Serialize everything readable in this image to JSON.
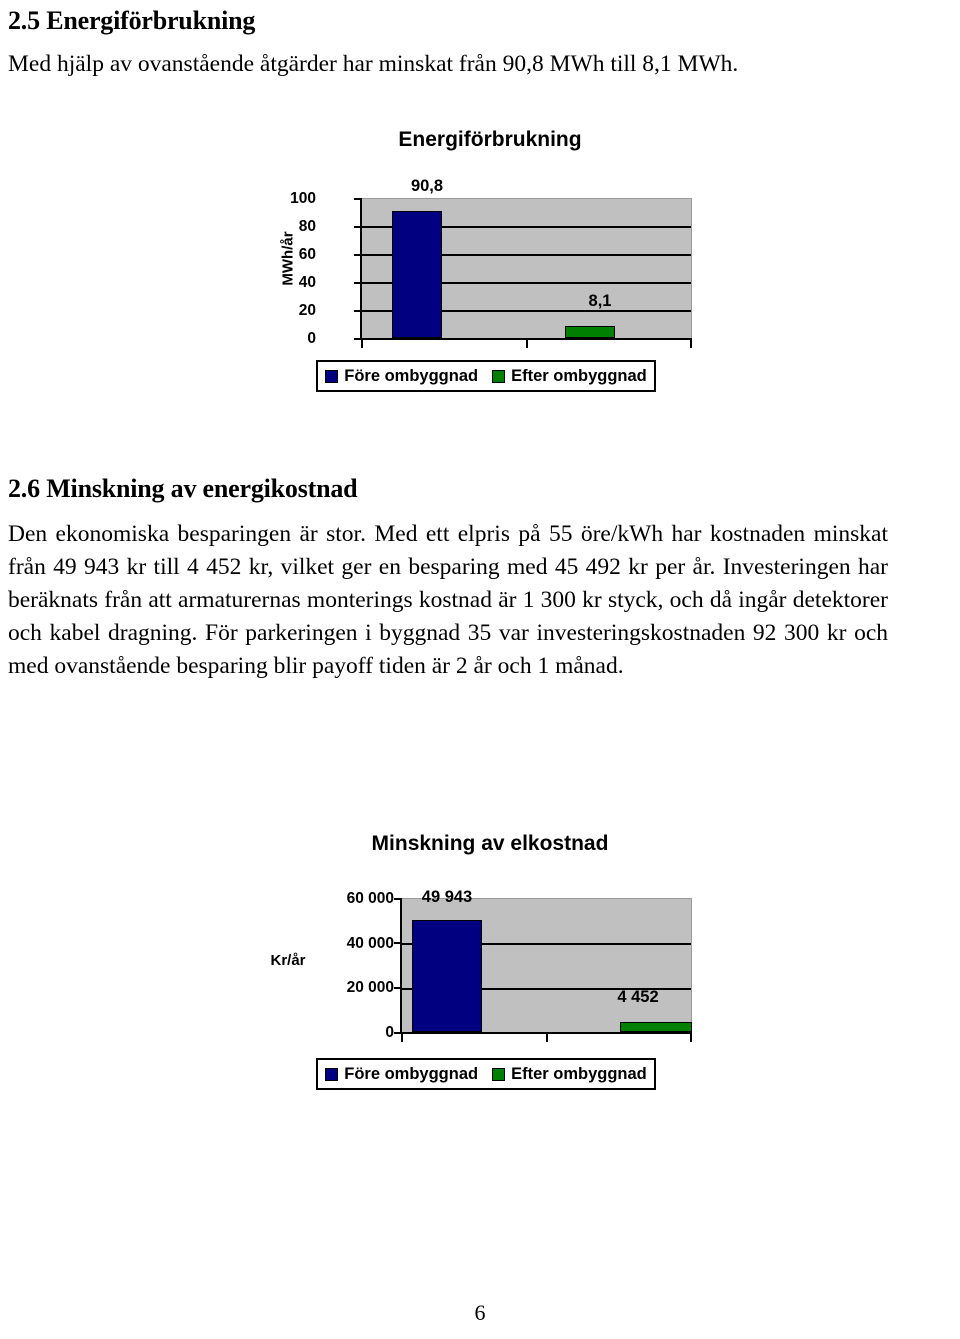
{
  "document": {
    "page_number": "6",
    "sections": [
      {
        "heading": "2.5 Energiförbrukning",
        "paragraph": "Med hjälp av ovanstående åtgärder har minskat från 90,8 MWh till 8,1 MWh."
      },
      {
        "heading": "2.6 Minskning av energikostnad",
        "paragraph": "Den ekonomiska besparingen är stor. Med ett elpris på 55 öre/kWh har kostnaden minskat från 49 943 kr till 4 452 kr, vilket ger en besparing med 45 492 kr per år. Investeringen har beräknats från att armaturernas monterings kostnad är 1 300 kr styck, och då ingår detektorer och kabel dragning. För parkeringen i byggnad 35 var investeringskostnaden 92 300 kr och med ovanstående besparing blir payoff tiden är 2 år och 1 månad."
      }
    ]
  },
  "chart_data": [
    {
      "type": "bar",
      "title": "Energiförbrukning",
      "xlabel": "",
      "ylabel": "MWh/år",
      "ylim": [
        0,
        100
      ],
      "yticks": [
        "100",
        "80",
        "60",
        "40",
        "20",
        "0"
      ],
      "ytick_values": [
        100,
        80,
        60,
        40,
        20,
        0
      ],
      "grid": true,
      "legend_position": "bottom",
      "categories": [
        "Före ombyggnad",
        "Efter ombyggnad"
      ],
      "values": [
        90.8,
        8.1
      ],
      "value_labels": [
        "90,8",
        "8,1"
      ],
      "colors": [
        "#000080",
        "#008000"
      ],
      "plot_background": "#c0c0c0"
    },
    {
      "type": "bar",
      "title": "Minskning av elkostnad",
      "xlabel": "",
      "ylabel": "Kr/år",
      "ylim": [
        0,
        60000
      ],
      "yticks": [
        "60 000",
        "40 000",
        "20 000",
        "0"
      ],
      "ytick_values": [
        60000,
        40000,
        20000,
        0
      ],
      "grid": true,
      "legend_position": "bottom",
      "categories": [
        "Före ombyggnad",
        "Efter ombyggnad"
      ],
      "values": [
        49943,
        4452
      ],
      "value_labels": [
        "49 943",
        "4 452"
      ],
      "colors": [
        "#000080",
        "#008000"
      ],
      "plot_background": "#c0c0c0"
    }
  ]
}
